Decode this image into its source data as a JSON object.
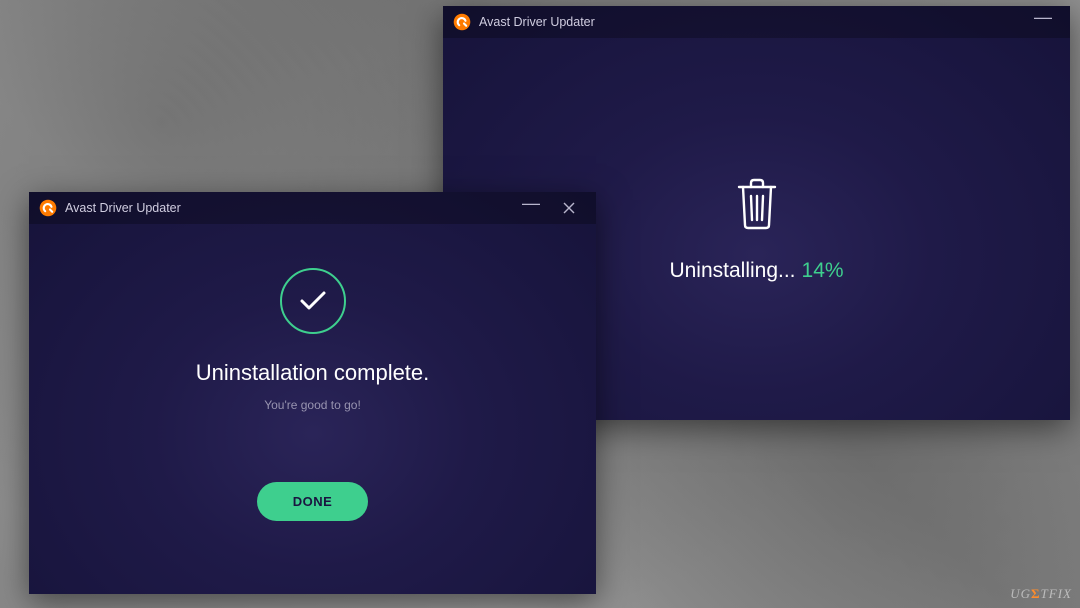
{
  "back_window": {
    "title": "Avast Driver Updater",
    "status_label": "Uninstalling...",
    "progress_percent": "14%"
  },
  "front_window": {
    "title": "Avast Driver Updater",
    "headline": "Uninstallation complete.",
    "subtext": "You're good to go!",
    "done_label": "DONE"
  },
  "watermark": "UGETFIX"
}
